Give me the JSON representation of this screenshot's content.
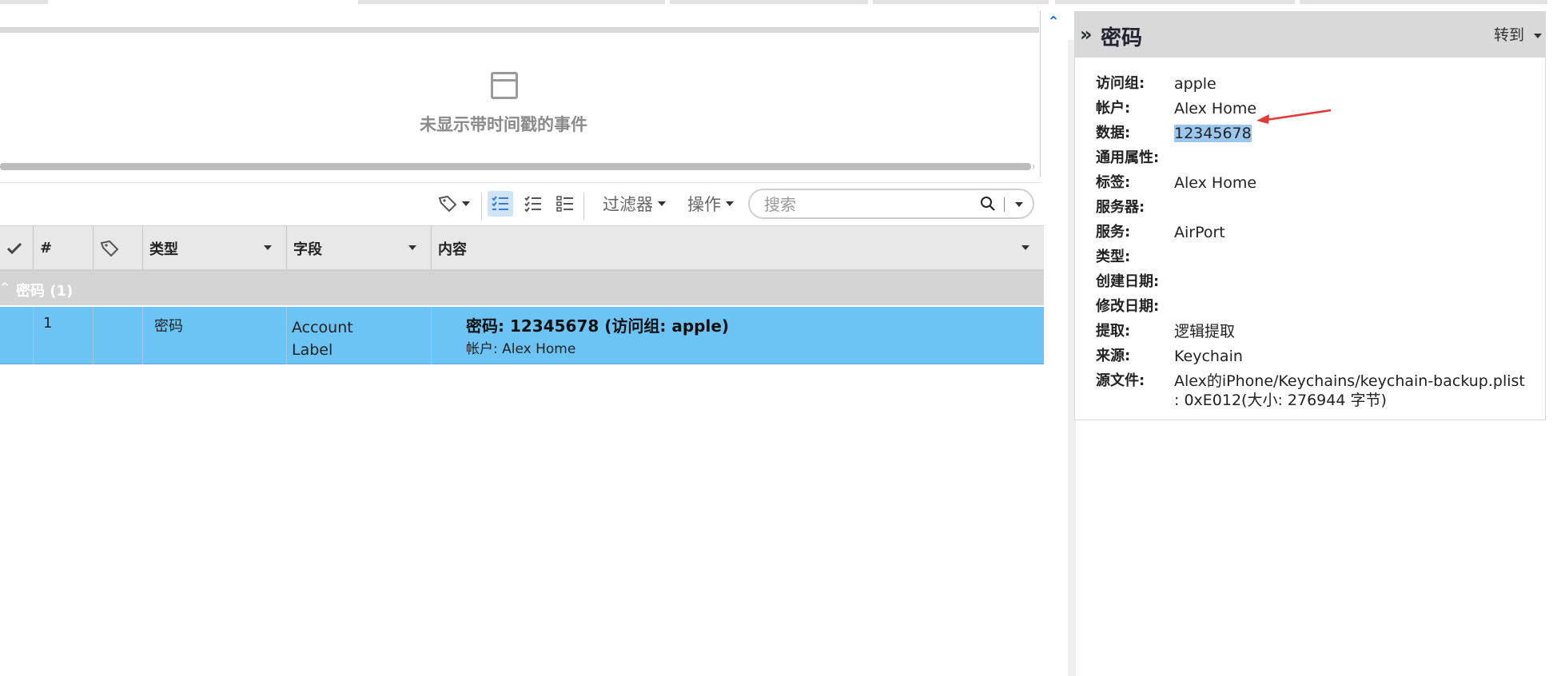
{
  "timeline": {
    "empty_text": "未显示带时间戳的事件"
  },
  "toolbar": {
    "filter_label": "过滤器",
    "actions_label": "操作",
    "search_placeholder": "搜索"
  },
  "table": {
    "columns": [
      {
        "label": ""
      },
      {
        "label": "#"
      },
      {
        "label": ""
      },
      {
        "label": "类型"
      },
      {
        "label": "字段"
      },
      {
        "label": "内容"
      }
    ],
    "group": {
      "label": "密码",
      "count": "(1)"
    },
    "rows": [
      {
        "index": "1",
        "type": "密码",
        "field_line1": "Account",
        "field_line2": "Label",
        "content_main": "密码: 12345678 (访问组: apple)",
        "content_sub": "帐户: Alex Home"
      }
    ]
  },
  "details": {
    "title": "密码",
    "goto_label": "转到",
    "properties": [
      {
        "label": "访问组:",
        "value": "apple"
      },
      {
        "label": "帐户:",
        "value": "Alex Home"
      },
      {
        "label": "数据:",
        "value": "12345678"
      },
      {
        "label": "通用属性:",
        "value": ""
      },
      {
        "label": "标签:",
        "value": "Alex Home"
      },
      {
        "label": "服务器:",
        "value": ""
      },
      {
        "label": "服务:",
        "value": "AirPort"
      },
      {
        "label": "类型:",
        "value": ""
      },
      {
        "label": "创建日期:",
        "value": ""
      },
      {
        "label": "修改日期:",
        "value": ""
      },
      {
        "label": "提取:",
        "value": "逻辑提取"
      },
      {
        "label": "来源:",
        "value": "Keychain"
      },
      {
        "label": "源文件:",
        "value": "Alex的iPhone/Keychains/keychain-backup.plist : 0xE012(大小: 276944 字节)"
      }
    ]
  },
  "colors": {
    "selection": "#6cc4f4",
    "highlight": "#9cc7ef",
    "annotation_arrow": "#e53935"
  }
}
